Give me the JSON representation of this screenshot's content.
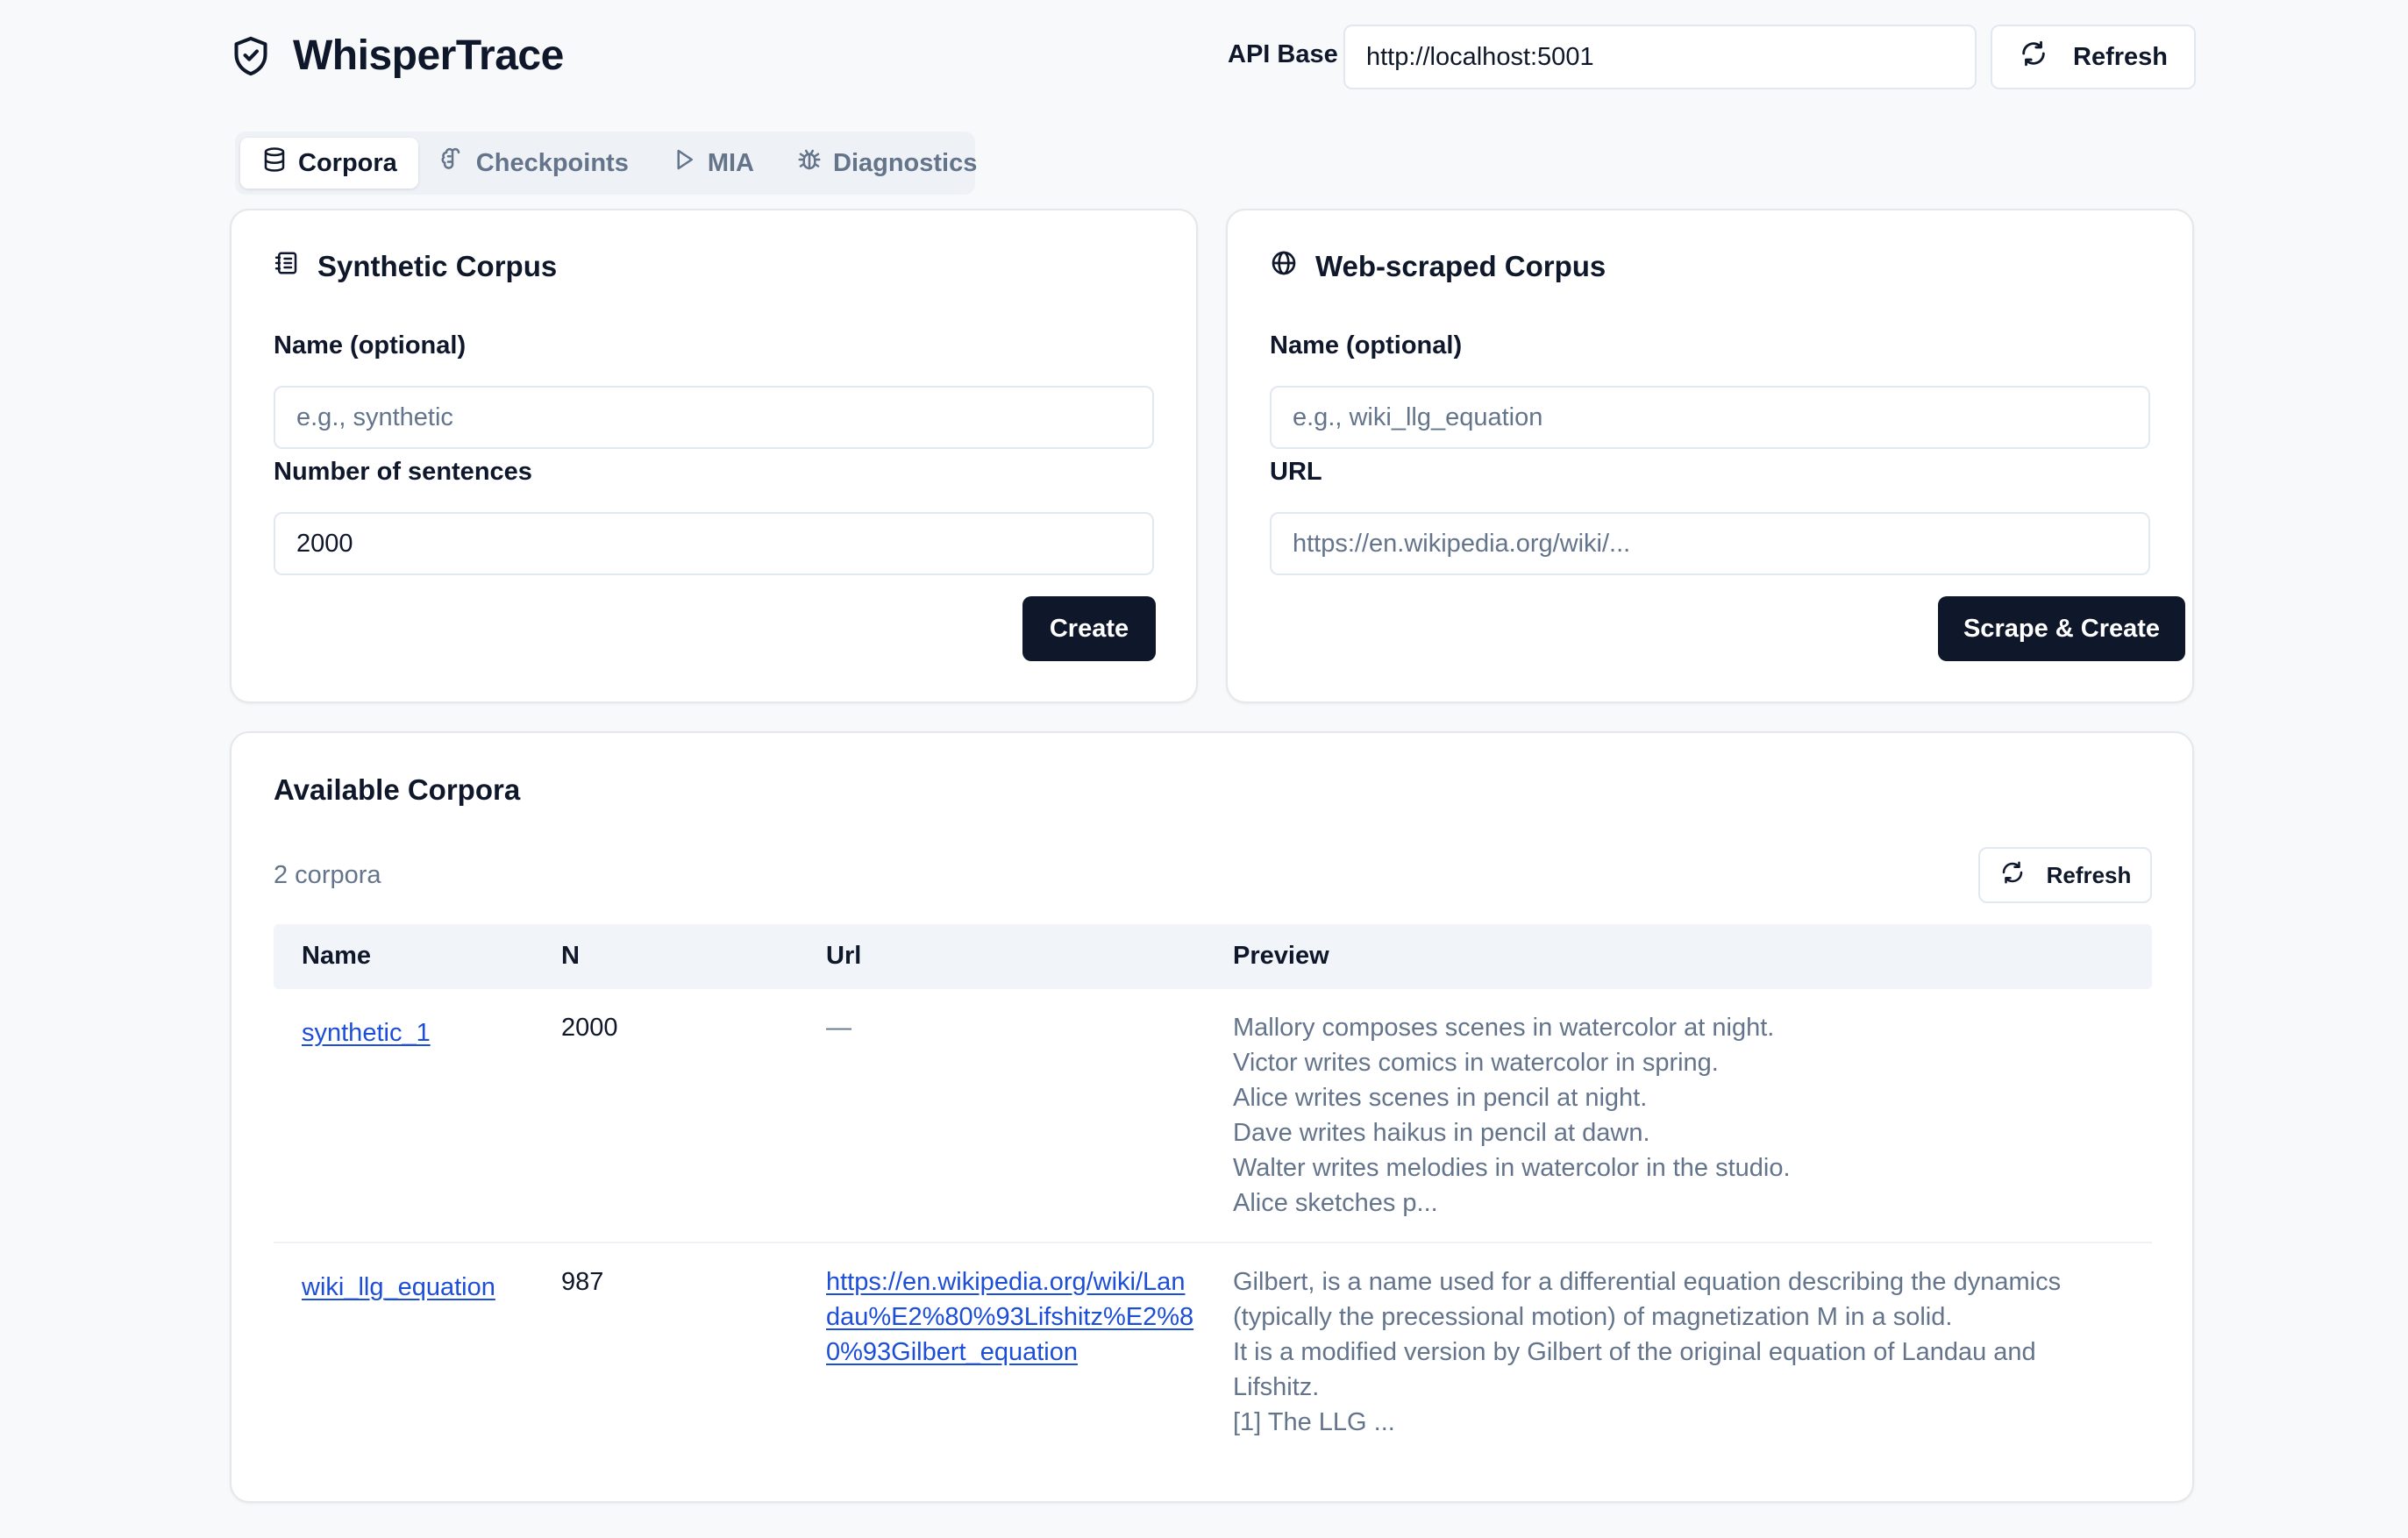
{
  "app": {
    "title": "WhisperTrace"
  },
  "header": {
    "api_label": "API Base",
    "api_value": "http://localhost:5001",
    "refresh_label": "Refresh"
  },
  "tabs": [
    {
      "label": "Corpora",
      "icon": "database-icon",
      "active": true
    },
    {
      "label": "Checkpoints",
      "icon": "brain-icon",
      "active": false
    },
    {
      "label": "MIA",
      "icon": "play-icon",
      "active": false
    },
    {
      "label": "Diagnostics",
      "icon": "bug-icon",
      "active": false
    }
  ],
  "synthetic": {
    "title": "Synthetic Corpus",
    "name_label": "Name (optional)",
    "name_placeholder": "e.g., synthetic",
    "sentences_label": "Number of sentences",
    "sentences_value": "2000",
    "create_label": "Create"
  },
  "web": {
    "title": "Web-scraped Corpus",
    "name_label": "Name (optional)",
    "name_placeholder": "e.g., wiki_llg_equation",
    "url_label": "URL",
    "url_placeholder": "https://en.wikipedia.org/wiki/...",
    "create_label": "Scrape & Create"
  },
  "corpora": {
    "title": "Available Corpora",
    "count_text": "2 corpora",
    "refresh_label": "Refresh",
    "columns": [
      "Name",
      "N",
      "Url",
      "Preview"
    ],
    "rows": [
      {
        "name": "synthetic_1",
        "n": "2000",
        "url": "—",
        "preview": [
          "Mallory composes scenes in watercolor at night.",
          "Victor writes comics in watercolor in spring.",
          "Alice writes scenes in pencil at night.",
          "Dave writes haikus in pencil at dawn.",
          "Walter writes melodies in watercolor in the studio.",
          "Alice sketches p..."
        ]
      },
      {
        "name": "wiki_llg_equation",
        "n": "987",
        "url": "https://en.wikipedia.org/wiki/Landau%E2%80%93Lifshitz%E2%80%93Gilbert_equation",
        "preview": [
          "Gilbert, is a name used for a differential equation describing the dynamics (typically the precessional motion) of magnetization M in a solid.",
          "It is a modified version by Gilbert of the original equation of Landau and Lifshitz.",
          "[1] The LLG ..."
        ]
      }
    ]
  }
}
